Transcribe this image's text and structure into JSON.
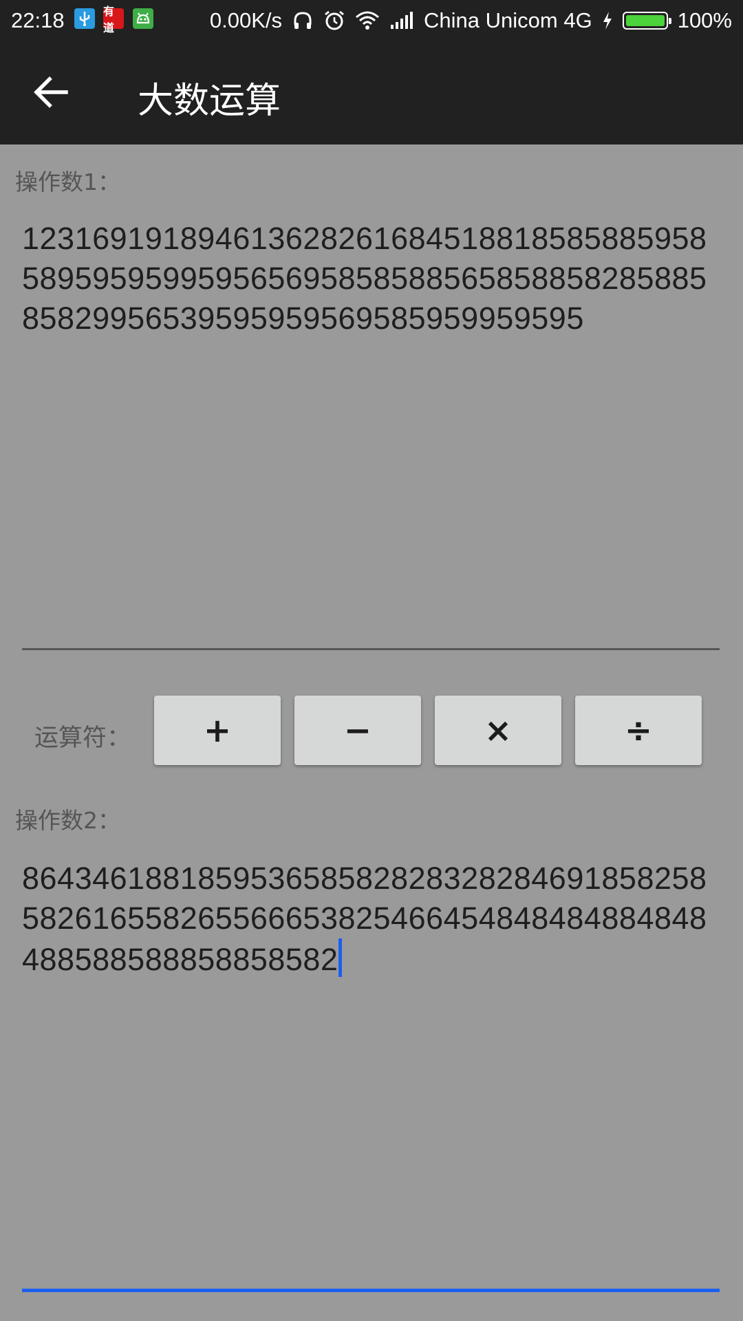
{
  "status_bar": {
    "time": "22:18",
    "notification_icons": [
      "usb-icon",
      "youdao-icon",
      "android-icon"
    ],
    "youdao_text": "有道",
    "network_speed": "0.00K/s",
    "carrier": "China Unicom 4G",
    "battery_percent": "100%",
    "battery_level": 1.0,
    "icons": [
      "headphones-icon",
      "alarm-icon",
      "wifi-icon",
      "signal-icon",
      "charging-icon",
      "battery-icon"
    ]
  },
  "app_bar": {
    "title": "大数运算",
    "back_icon": "back-arrow-icon"
  },
  "operand1": {
    "label": "操作数1：",
    "value": "12316919189461362826168451881858588595858959595995956569585858856585885828588585829956539595959569585959959595"
  },
  "operators": {
    "label": "运算符：",
    "buttons": [
      "+",
      "−",
      "×",
      "÷"
    ]
  },
  "operand2": {
    "label": "操作数2：",
    "value": "864346188185953658582828328284691858258582616558265566653825466454848484884848488588588858858582"
  },
  "colors": {
    "background": "#9a9a9a",
    "toolbar": "#212121",
    "accent": "#1a5fef",
    "button": "#d6d7d7"
  }
}
